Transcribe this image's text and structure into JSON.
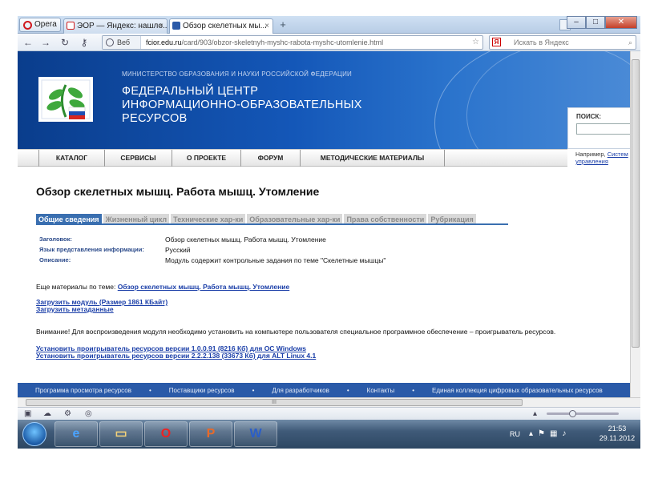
{
  "browser": {
    "menu_button": "Opera",
    "tabs": [
      {
        "title": "ЭОР — Яндекс: нашло..."
      },
      {
        "title": "Обзор скелетных мы..."
      }
    ],
    "new_tab": "+",
    "nav": {
      "back": "←",
      "forward": "→",
      "reload": "↻",
      "key": "⚷"
    },
    "address": {
      "prefix": "Веб",
      "domain": "fcior.edu.ru",
      "path": "/card/903/obzor-skeletnyh-myshc-rabota-myshc-utomlenie.html"
    },
    "search_placeholder": "Искать в Яндекс",
    "search_engine": "Я"
  },
  "site": {
    "ministry": "МИНИСТЕРСТВО ОБРАЗОВАНИЯ И НАУКИ РОССИЙСКОЙ ФЕДЕРАЦИИ",
    "name_line1": "ФЕДЕРАЛЬНЫЙ ЦЕНТР",
    "name_line2": "ИНФОРМАЦИОННО-ОБРАЗОВАТЕЛЬНЫХ",
    "name_line3": "РЕСУРСОВ",
    "search_label": "ПОИСК:",
    "example_prefix": "Например,",
    "example_link": "Систем управления",
    "menu": [
      "КАТАЛОГ",
      "СЕРВИСЫ",
      "О ПРОЕКТЕ",
      "ФОРУМ",
      "МЕТОДИЧЕСКИЕ МАТЕРИАЛЫ"
    ]
  },
  "content": {
    "title": "Обзор скелетных мышц. Работа мышц. Утомление",
    "tabs": [
      "Общие сведения",
      "Жизненный цикл",
      "Технические хар-ки",
      "Образовательные хар-ки",
      "Права собственности",
      "Рубрикация"
    ],
    "active_tab": 0,
    "meta": [
      {
        "key": "Заголовок:",
        "value": "Обзор скелетных мышц. Работа мышц. Утомление"
      },
      {
        "key": "Язык представления информации:",
        "value": "Русский"
      },
      {
        "key": "Описание:",
        "value": "Модуль содержит контрольные задания по теме \"Скелетные мышцы\""
      }
    ],
    "more_label": "Еще материалы по теме:",
    "more_link": "Обзор скелетных мышц. Работа мышц. Утомление",
    "download_module": "Загрузить модуль (Размер 1861 КБайт)",
    "download_meta": "Загрузить метаданные",
    "warning": "Внимание! Для воспроизведения модуля необходимо установить на компьютере пользователя специальное программное обеспечение – проигрыватель ресурсов.",
    "install_windows": "Установить проигрыватель ресурсов версии 1.0.0.91 (8216 Кб) для ОС Windows",
    "install_linux": "Установить проигрыватель ресурсов версии 2.2.2.138 (33673 Кб) для ALT Linux 4.1"
  },
  "footer": [
    "Программа просмотра ресурсов",
    "Поставщики ресурсов",
    "Для разработчиков",
    "Контакты",
    "Единая коллекция цифровых образовательных ресурсов"
  ],
  "footer_separator": "•",
  "scrollbar_grip": "III",
  "taskbar": {
    "apps": [
      {
        "icon": "e",
        "name": "internet-explorer"
      },
      {
        "icon": "▭",
        "name": "file-explorer"
      },
      {
        "icon": "O",
        "name": "opera"
      },
      {
        "icon": "P",
        "name": "powerpoint"
      },
      {
        "icon": "W",
        "name": "word"
      }
    ],
    "lang": "RU",
    "time": "21:53",
    "date": "29.11.2012"
  },
  "colors": {
    "banner": "#1457b8",
    "footer": "#2a5aa8",
    "tab_active": "#3a6fb0",
    "link": "#1a3ea8"
  }
}
